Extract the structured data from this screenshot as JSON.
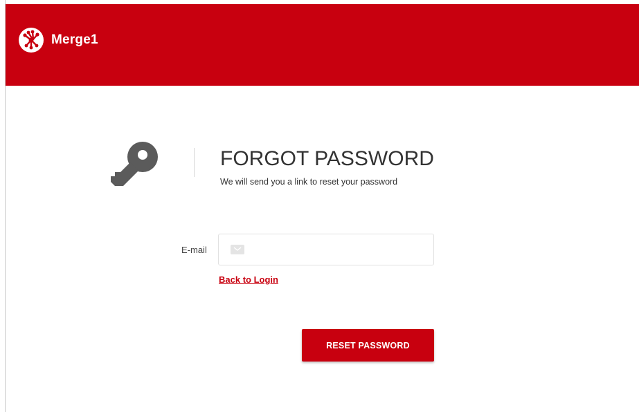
{
  "brand": {
    "name": "Merge1",
    "header_color": "#c8000f",
    "logo_icon": "merge1-logo-icon"
  },
  "page": {
    "title": "FORGOT PASSWORD",
    "subtitle": "We will send you a link to reset your password",
    "hero_icon": "key-icon"
  },
  "form": {
    "email_label": "E-mail",
    "email_value": "",
    "email_placeholder": "",
    "email_icon": "mail-icon",
    "back_link_label": "Back to Login",
    "submit_label": "RESET PASSWORD",
    "accent_color": "#c8000f"
  }
}
